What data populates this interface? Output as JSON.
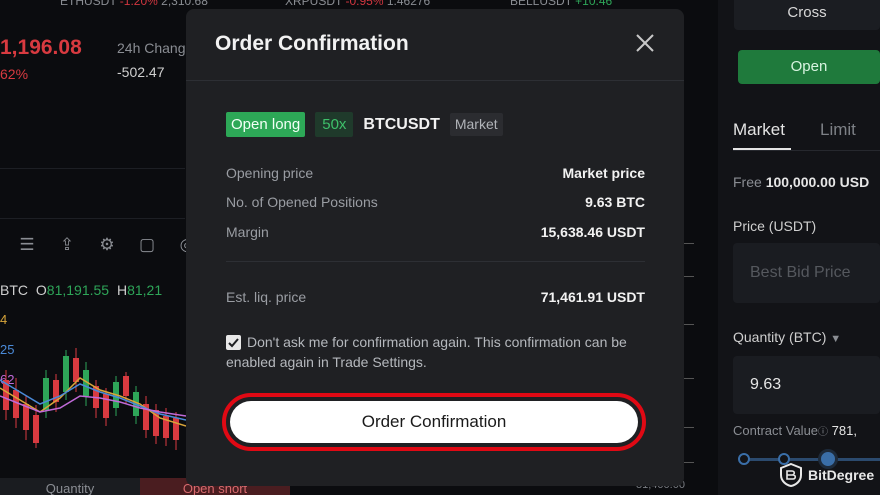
{
  "background": {
    "tickers": [
      {
        "symbol": "ETHUSDT",
        "change": "-1.20%",
        "price": "2,310.68",
        "change_class": "neg"
      },
      {
        "symbol": "XRPUSDT",
        "change": "-0.95%",
        "price": "1.46276",
        "change_class": "neg"
      },
      {
        "symbol": "BELLUSDT",
        "change": "+10.46",
        "price": "",
        "change_class": "pos"
      }
    ],
    "last_price": "1,196.08",
    "last_pct": "62%",
    "change_24h_label": "24h Chang",
    "change_24h_value": "-502.47",
    "ohlc": {
      "symbol": "BTC",
      "open_label": "O",
      "open_value": "81,191.55",
      "high_label": "H",
      "high_value": "81,21"
    },
    "ma_labels": [
      "4",
      "25",
      "62"
    ],
    "bottom_tabs": {
      "quantity": "Quantity",
      "open_short": "Open short"
    },
    "axis_price": "81,400.00"
  },
  "panel": {
    "margin_mode": "Cross",
    "open_button": "Open",
    "tabs": {
      "market": "Market",
      "limit": "Limit"
    },
    "free_label": "Free",
    "free_value": "100,000.00 USD",
    "price_label": "Price (USDT)",
    "price_placeholder": "Best Bid Price",
    "quantity_label": "Quantity (BTC)",
    "quantity_value": "9.63",
    "contract_value_label": "Contract Value",
    "contract_value": "781,"
  },
  "watermark": "BitDegree",
  "modal": {
    "title": "Order Confirmation",
    "tags": {
      "side": "Open long",
      "leverage": "50x",
      "symbol": "BTCUSDT",
      "order_type": "Market"
    },
    "rows": [
      {
        "key": "Opening price",
        "value": "Market price"
      },
      {
        "key": "No. of Opened Positions",
        "value": "9.63 BTC"
      },
      {
        "key": "Margin",
        "value": "15,638.46 USDT"
      }
    ],
    "est_liq": {
      "key": "Est. liq. price",
      "value": "71,461.91 USDT"
    },
    "dont_ask_text": "Don't ask me for confirmation again. This confirmation can be enabled again in Trade Settings.",
    "dont_ask_checked": true,
    "confirm_button": "Order Confirmation"
  },
  "colors": {
    "long": "#2da857",
    "short": "#d83a40",
    "highlight_outline": "#e00914",
    "accent_blue": "#3a6ea8"
  }
}
